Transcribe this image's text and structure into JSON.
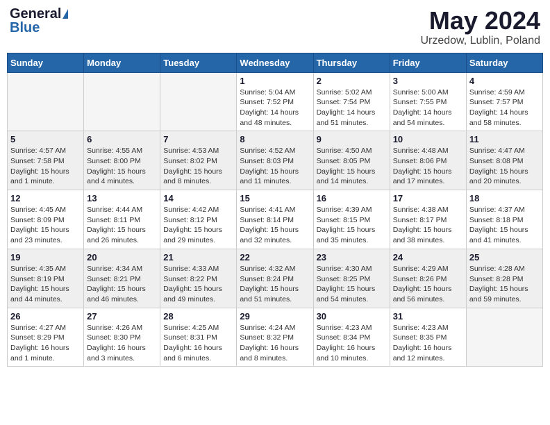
{
  "logo": {
    "general": "General",
    "blue": "Blue"
  },
  "title": "May 2024",
  "location": "Urzedow, Lublin, Poland",
  "weekdays": [
    "Sunday",
    "Monday",
    "Tuesday",
    "Wednesday",
    "Thursday",
    "Friday",
    "Saturday"
  ],
  "weeks": [
    [
      {
        "day": "",
        "info": ""
      },
      {
        "day": "",
        "info": ""
      },
      {
        "day": "",
        "info": ""
      },
      {
        "day": "1",
        "info": "Sunrise: 5:04 AM\nSunset: 7:52 PM\nDaylight: 14 hours\nand 48 minutes."
      },
      {
        "day": "2",
        "info": "Sunrise: 5:02 AM\nSunset: 7:54 PM\nDaylight: 14 hours\nand 51 minutes."
      },
      {
        "day": "3",
        "info": "Sunrise: 5:00 AM\nSunset: 7:55 PM\nDaylight: 14 hours\nand 54 minutes."
      },
      {
        "day": "4",
        "info": "Sunrise: 4:59 AM\nSunset: 7:57 PM\nDaylight: 14 hours\nand 58 minutes."
      }
    ],
    [
      {
        "day": "5",
        "info": "Sunrise: 4:57 AM\nSunset: 7:58 PM\nDaylight: 15 hours\nand 1 minute."
      },
      {
        "day": "6",
        "info": "Sunrise: 4:55 AM\nSunset: 8:00 PM\nDaylight: 15 hours\nand 4 minutes."
      },
      {
        "day": "7",
        "info": "Sunrise: 4:53 AM\nSunset: 8:02 PM\nDaylight: 15 hours\nand 8 minutes."
      },
      {
        "day": "8",
        "info": "Sunrise: 4:52 AM\nSunset: 8:03 PM\nDaylight: 15 hours\nand 11 minutes."
      },
      {
        "day": "9",
        "info": "Sunrise: 4:50 AM\nSunset: 8:05 PM\nDaylight: 15 hours\nand 14 minutes."
      },
      {
        "day": "10",
        "info": "Sunrise: 4:48 AM\nSunset: 8:06 PM\nDaylight: 15 hours\nand 17 minutes."
      },
      {
        "day": "11",
        "info": "Sunrise: 4:47 AM\nSunset: 8:08 PM\nDaylight: 15 hours\nand 20 minutes."
      }
    ],
    [
      {
        "day": "12",
        "info": "Sunrise: 4:45 AM\nSunset: 8:09 PM\nDaylight: 15 hours\nand 23 minutes."
      },
      {
        "day": "13",
        "info": "Sunrise: 4:44 AM\nSunset: 8:11 PM\nDaylight: 15 hours\nand 26 minutes."
      },
      {
        "day": "14",
        "info": "Sunrise: 4:42 AM\nSunset: 8:12 PM\nDaylight: 15 hours\nand 29 minutes."
      },
      {
        "day": "15",
        "info": "Sunrise: 4:41 AM\nSunset: 8:14 PM\nDaylight: 15 hours\nand 32 minutes."
      },
      {
        "day": "16",
        "info": "Sunrise: 4:39 AM\nSunset: 8:15 PM\nDaylight: 15 hours\nand 35 minutes."
      },
      {
        "day": "17",
        "info": "Sunrise: 4:38 AM\nSunset: 8:17 PM\nDaylight: 15 hours\nand 38 minutes."
      },
      {
        "day": "18",
        "info": "Sunrise: 4:37 AM\nSunset: 8:18 PM\nDaylight: 15 hours\nand 41 minutes."
      }
    ],
    [
      {
        "day": "19",
        "info": "Sunrise: 4:35 AM\nSunset: 8:19 PM\nDaylight: 15 hours\nand 44 minutes."
      },
      {
        "day": "20",
        "info": "Sunrise: 4:34 AM\nSunset: 8:21 PM\nDaylight: 15 hours\nand 46 minutes."
      },
      {
        "day": "21",
        "info": "Sunrise: 4:33 AM\nSunset: 8:22 PM\nDaylight: 15 hours\nand 49 minutes."
      },
      {
        "day": "22",
        "info": "Sunrise: 4:32 AM\nSunset: 8:24 PM\nDaylight: 15 hours\nand 51 minutes."
      },
      {
        "day": "23",
        "info": "Sunrise: 4:30 AM\nSunset: 8:25 PM\nDaylight: 15 hours\nand 54 minutes."
      },
      {
        "day": "24",
        "info": "Sunrise: 4:29 AM\nSunset: 8:26 PM\nDaylight: 15 hours\nand 56 minutes."
      },
      {
        "day": "25",
        "info": "Sunrise: 4:28 AM\nSunset: 8:28 PM\nDaylight: 15 hours\nand 59 minutes."
      }
    ],
    [
      {
        "day": "26",
        "info": "Sunrise: 4:27 AM\nSunset: 8:29 PM\nDaylight: 16 hours\nand 1 minute."
      },
      {
        "day": "27",
        "info": "Sunrise: 4:26 AM\nSunset: 8:30 PM\nDaylight: 16 hours\nand 3 minutes."
      },
      {
        "day": "28",
        "info": "Sunrise: 4:25 AM\nSunset: 8:31 PM\nDaylight: 16 hours\nand 6 minutes."
      },
      {
        "day": "29",
        "info": "Sunrise: 4:24 AM\nSunset: 8:32 PM\nDaylight: 16 hours\nand 8 minutes."
      },
      {
        "day": "30",
        "info": "Sunrise: 4:23 AM\nSunset: 8:34 PM\nDaylight: 16 hours\nand 10 minutes."
      },
      {
        "day": "31",
        "info": "Sunrise: 4:23 AM\nSunset: 8:35 PM\nDaylight: 16 hours\nand 12 minutes."
      },
      {
        "day": "",
        "info": ""
      }
    ]
  ]
}
